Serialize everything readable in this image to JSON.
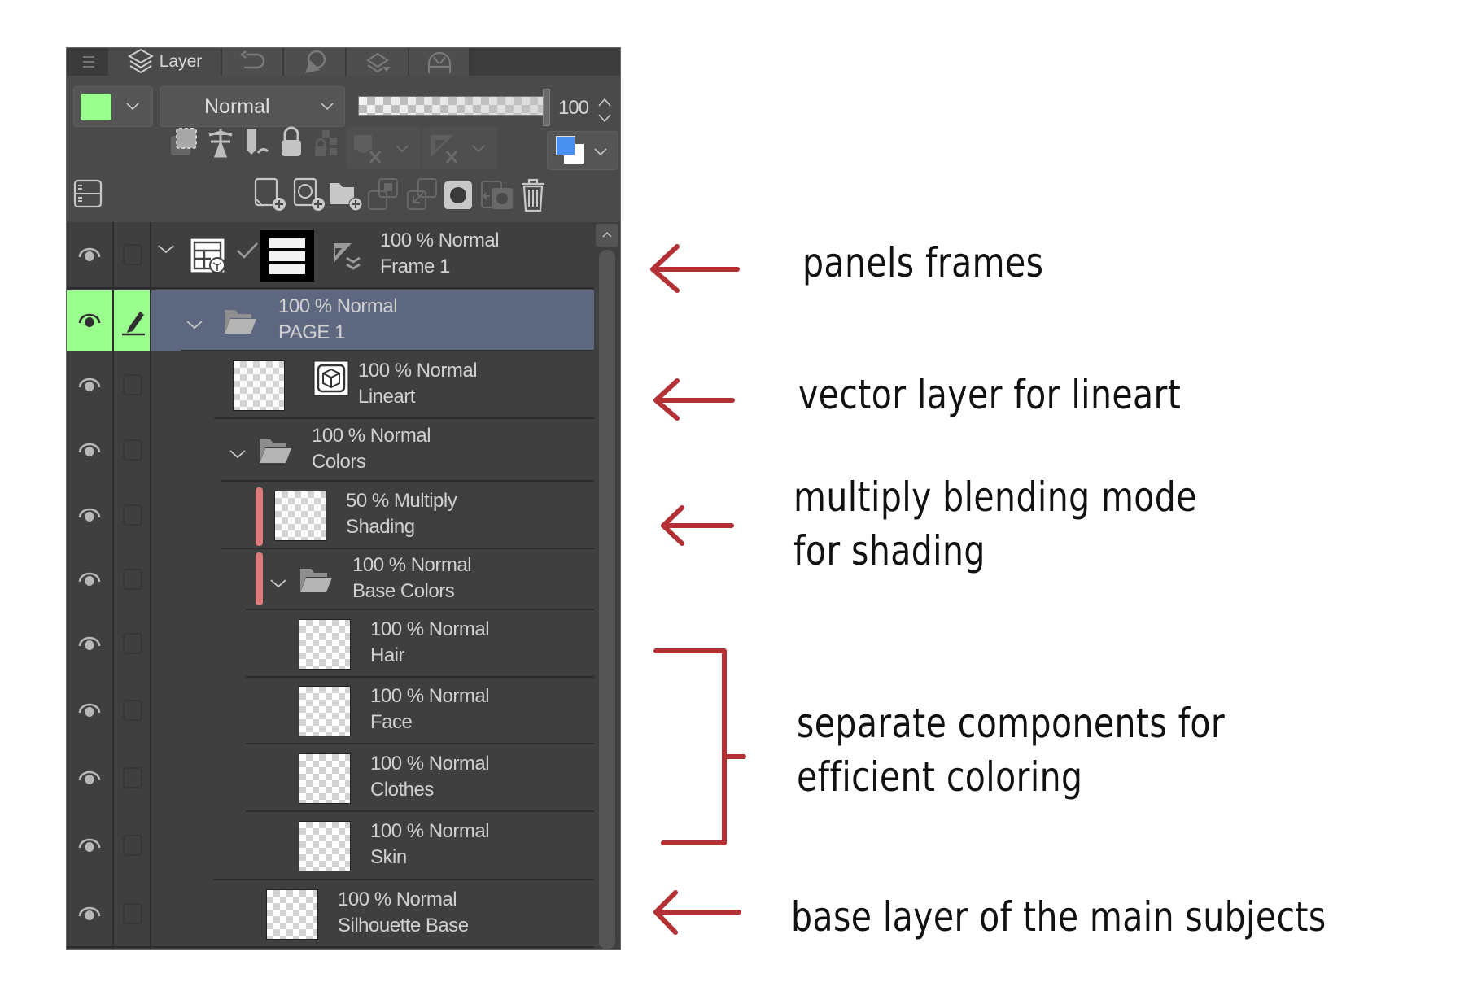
{
  "panel": {
    "tabs": [
      {
        "icon": "menu-icon",
        "label": ""
      },
      {
        "icon": "layers-icon",
        "label": "Layer",
        "active": true
      },
      {
        "icon": "history-undo-icon",
        "label": ""
      },
      {
        "icon": "color-set-icon",
        "label": ""
      },
      {
        "icon": "layer-property-icon",
        "label": ""
      },
      {
        "icon": "navigator-icon",
        "label": ""
      }
    ],
    "layer_color": "#9bff8f",
    "blend_mode": "Normal",
    "opacity": 100,
    "opacity_label": "100",
    "draw_color_main": "#4a90f0",
    "draw_color_sub": "#ffffff",
    "property_icons": [
      "clip-to-layer-below-icon",
      "reference-layer-icon",
      "draft-layer-icon",
      "lock-layer-icon",
      "lock-transparent-pixels-icon",
      "mask-icon",
      "ruler-icon"
    ],
    "action_icons": [
      "new-raster-layer-icon",
      "new-vector-layer-icon",
      "new-folder-icon",
      "transfer-to-lower-layer-icon",
      "combine-with-layer-below-icon",
      "create-layer-mask-icon",
      "apply-mask-icon",
      "delete-layer-icon"
    ],
    "layers": [
      {
        "name": "Frame 1",
        "blend": "100 % Normal",
        "type": "frame-folder",
        "visible": true,
        "selected": false,
        "expanded": true
      },
      {
        "name": "PAGE 1",
        "blend": "100 % Normal",
        "type": "folder",
        "visible": true,
        "selected": true,
        "expanded": true
      },
      {
        "name": "Lineart",
        "blend": "100 % Normal",
        "type": "vector",
        "visible": true,
        "selected": false
      },
      {
        "name": "Colors",
        "blend": "100 % Normal",
        "type": "folder",
        "visible": true,
        "selected": false,
        "expanded": true
      },
      {
        "name": "Shading",
        "blend": "50 % Multiply",
        "type": "raster",
        "visible": true,
        "selected": false,
        "clipped": true
      },
      {
        "name": "Base Colors",
        "blend": "100 % Normal",
        "type": "folder",
        "visible": true,
        "selected": false,
        "clipped": true,
        "expanded": true
      },
      {
        "name": "Hair",
        "blend": "100 % Normal",
        "type": "raster",
        "visible": true,
        "selected": false
      },
      {
        "name": "Face",
        "blend": "100 % Normal",
        "type": "raster",
        "visible": true,
        "selected": false
      },
      {
        "name": "Clothes",
        "blend": "100 % Normal",
        "type": "raster",
        "visible": true,
        "selected": false
      },
      {
        "name": "Skin",
        "blend": "100 % Normal",
        "type": "raster",
        "visible": true,
        "selected": false
      },
      {
        "name": "Silhouette Base",
        "blend": "100 % Normal",
        "type": "raster",
        "visible": true,
        "selected": false
      }
    ],
    "selected_highlight": "#5e6780",
    "clip_indicator_color": "#e07b7b"
  },
  "annotations": {
    "color": "#b33035",
    "panels_frames": "panels frames",
    "vector_lineart": "vector layer for lineart",
    "multiply_line1": "multiply blending mode",
    "multiply_line2": "for shading",
    "separate_line1": "separate components for",
    "separate_line2": "efficient coloring",
    "base_layer": "base layer of the main subjects"
  }
}
